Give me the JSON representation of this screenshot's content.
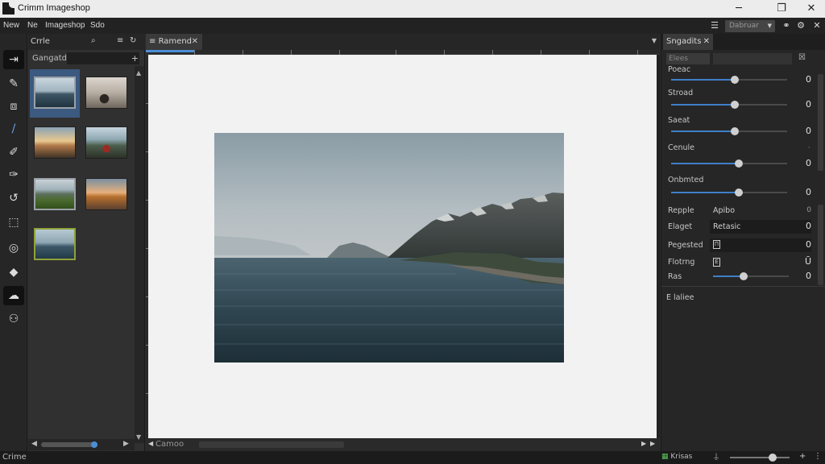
{
  "window": {
    "title": "Crimm Imageshop",
    "minimize_icon": "─",
    "restore_icon": "❐",
    "close_icon": "✕"
  },
  "menubar": {
    "items": [
      "New",
      "Ne",
      "Imageshop",
      "Sdo"
    ],
    "mode_select": "Dabruar"
  },
  "thumbnails_panel": {
    "tab_label": "Crrle",
    "filter_label": "Gangatd",
    "thumbnails": [
      {
        "name": "lake-horizon",
        "selected": true
      },
      {
        "name": "car-road-sepia",
        "selected": false
      },
      {
        "name": "sunset-road",
        "selected": false
      },
      {
        "name": "red-car-road",
        "selected": false
      },
      {
        "name": "green-field-mountains",
        "selected": false,
        "outlined": true
      },
      {
        "name": "sunset-hills",
        "selected": false
      },
      {
        "name": "lake-shore",
        "selected": false,
        "green_border": true
      }
    ]
  },
  "document": {
    "tab_label": "Ramend",
    "scroll_label": "Camoo"
  },
  "adjustments_panel": {
    "tab_label": "Sngadits",
    "search_label": "Elees",
    "sliders": [
      {
        "label": "Poeac",
        "value": "0",
        "position": 0.55
      },
      {
        "label": "Stroad",
        "value": "0",
        "position": 0.55
      },
      {
        "label": "Saeat",
        "value": "0",
        "position": 0.55
      },
      {
        "label": "Cenule",
        "value": "0",
        "position": 0.58
      },
      {
        "label": "Onbmted",
        "value": "0",
        "position": 0.58
      }
    ],
    "fields": [
      {
        "label": "Repple",
        "text": "Apibo",
        "value": "0"
      },
      {
        "label": "Elaget",
        "text": "Retasic",
        "value": "0"
      },
      {
        "label": "Pegested",
        "icon": "Π",
        "value": "0"
      },
      {
        "label": "Flotrng",
        "icon": "Ë",
        "value": "Ū"
      },
      {
        "label": "Ras",
        "slider_position": 0.4,
        "value": "0"
      }
    ],
    "section_label": "E laliee"
  },
  "statusbar": {
    "status": "Crime",
    "zoom_label": "Krisas",
    "zoom_position": 0.72
  }
}
